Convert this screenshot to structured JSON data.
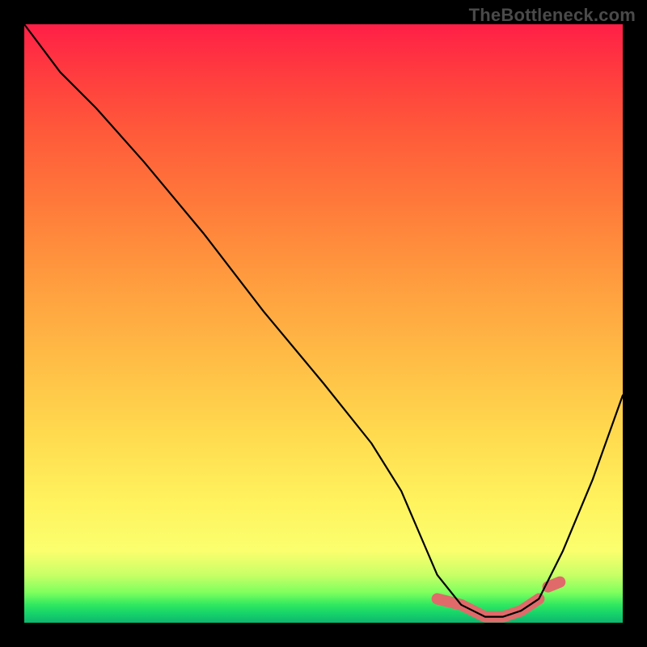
{
  "watermark": "TheBottleneck.com",
  "colors": {
    "background": "#000000",
    "curve": "#000000",
    "valley_highlight": "#e06a6a",
    "gradient_top": "#ff1f47",
    "gradient_bottom": "#0fb56e"
  },
  "chart_data": {
    "type": "line",
    "title": "",
    "xlabel": "",
    "ylabel": "",
    "xlim": [
      0,
      100
    ],
    "ylim": [
      0,
      100
    ],
    "grid": false,
    "legend": false,
    "series": [
      {
        "name": "bottleneck-curve",
        "x": [
          0,
          6,
          12,
          20,
          30,
          40,
          50,
          58,
          63,
          66,
          69,
          73,
          77,
          80,
          83,
          86,
          90,
          95,
          100
        ],
        "y": [
          100,
          92,
          86,
          77,
          65,
          52,
          40,
          30,
          22,
          15,
          8,
          3,
          1,
          1,
          2,
          4,
          12,
          24,
          38
        ]
      }
    ],
    "annotations": [
      {
        "name": "optimal-range",
        "x_range": [
          69,
          86
        ],
        "y_approx": 2,
        "note": "valley highlighted in salmon"
      }
    ],
    "background_gradient": {
      "direction": "top-to-bottom",
      "stops": [
        {
          "pos": 0.0,
          "color": "#ff1f47"
        },
        {
          "pos": 0.3,
          "color": "#ff7a3a"
        },
        {
          "pos": 0.68,
          "color": "#ffd94e"
        },
        {
          "pos": 0.88,
          "color": "#fbff6e"
        },
        {
          "pos": 0.95,
          "color": "#7dff5e"
        },
        {
          "pos": 1.0,
          "color": "#0fb56e"
        }
      ]
    }
  }
}
